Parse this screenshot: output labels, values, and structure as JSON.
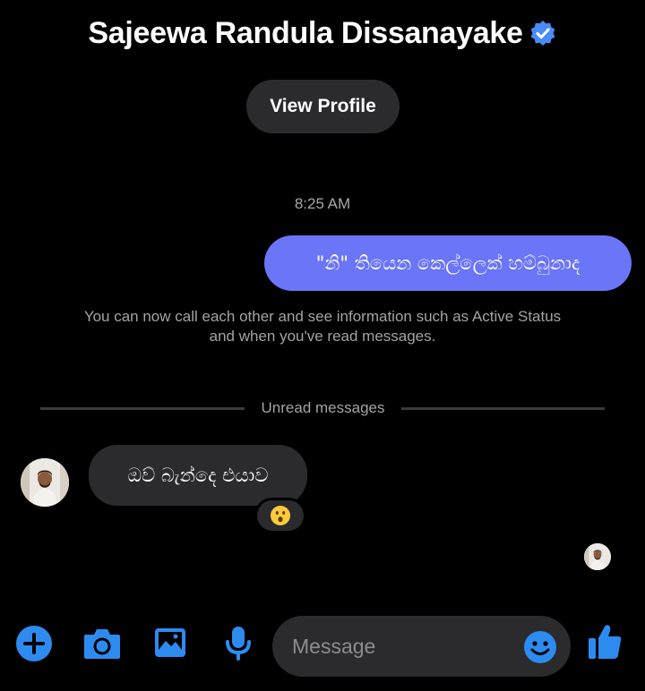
{
  "header": {
    "contact_name": "Sajeewa Randula Dissanayake",
    "verified_icon": "verified-badge-icon",
    "view_profile_label": "View Profile"
  },
  "conversation": {
    "timestamp": "8:25 AM",
    "outgoing_message": "\"නි\" තියෙන කෙල්ලෙක් හම්බුනාද",
    "notice": "You can now call each other and see information such as Active Status and when you've read messages.",
    "unread_divider": "Unread messages",
    "incoming_message": "ඔව් බැන්දෙ එයාව",
    "reaction_emoji": "surprised-face-icon"
  },
  "composer": {
    "placeholder": "Message",
    "icons": [
      "plus-icon",
      "camera-icon",
      "gallery-icon",
      "microphone-icon",
      "emoji-icon",
      "thumbs-up-icon"
    ]
  },
  "colors": {
    "background": "#000000",
    "outgoing_bubble": "#6a75f7",
    "incoming_bubble": "#2b2b2e",
    "accent_blue": "#2d8bf0",
    "secondary_text": "#a3a3a6"
  }
}
